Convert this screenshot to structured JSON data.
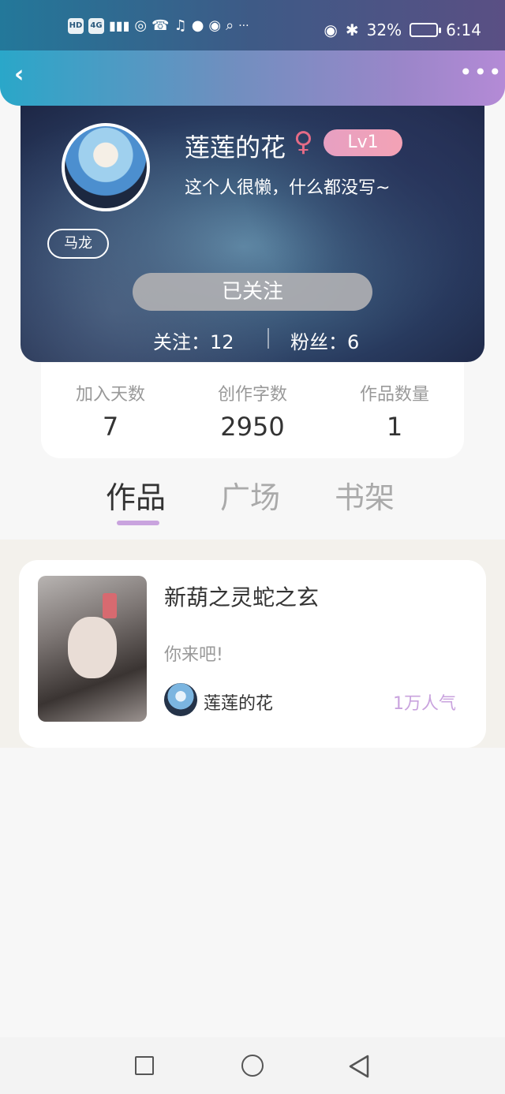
{
  "status_bar": {
    "icons": [
      "HD",
      "4G",
      "signal-icon",
      "hotspot-icon",
      "missed-call-icon",
      "music-icon",
      "chat-bubble-icon",
      "wechat-icon",
      "search-app-icon"
    ],
    "overflow": "···",
    "eye_icon": "eye-icon",
    "bluetooth_icon": "bluetooth-icon",
    "battery": "32%",
    "time": "6:14"
  },
  "appbar": {
    "back_icon": "‹",
    "more_icon": "•••"
  },
  "profile": {
    "username": "莲莲的花",
    "gender_symbol": "♀",
    "level": "Lv1",
    "bio": "这个人很懒，什么都没写~",
    "tag": "马龙",
    "follow_button": "已关注",
    "following": "关注：12",
    "fans": "粉丝：6"
  },
  "stats": [
    {
      "label": "加入天数",
      "value": "7"
    },
    {
      "label": "创作字数",
      "value": "2950"
    },
    {
      "label": "作品数量",
      "value": "1"
    }
  ],
  "tabs": [
    {
      "label": "作品",
      "active": true
    },
    {
      "label": "广场",
      "active": false
    },
    {
      "label": "书架",
      "active": false
    }
  ],
  "works": [
    {
      "title": "新葫之灵蛇之玄",
      "description": "你来吧!",
      "author": "莲莲的花",
      "popularity": "1万人气"
    }
  ],
  "colors": {
    "accent_purple": "#c9a3de",
    "gender_pink": "#e56b86"
  }
}
